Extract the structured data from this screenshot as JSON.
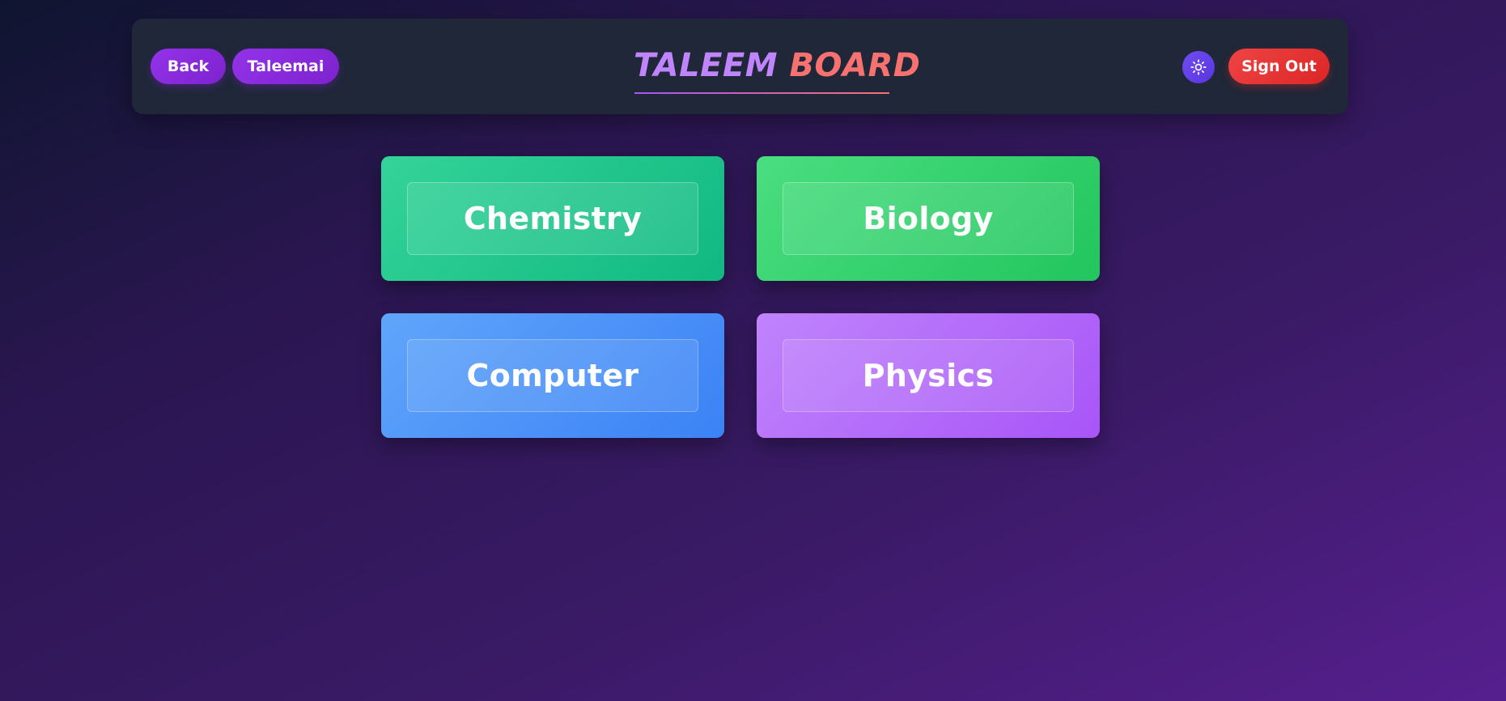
{
  "header": {
    "back_label": "Back",
    "taleemai_label": "Taleemai",
    "brand_part1": "TALEEM",
    "brand_part2": "BOARD",
    "theme_toggle_icon": "sun-icon",
    "signout_label": "Sign Out"
  },
  "subjects": [
    {
      "label": "Chemistry",
      "color": "#10b981"
    },
    {
      "label": "Biology",
      "color": "#22c55e"
    },
    {
      "label": "Computer",
      "color": "#3b82f6"
    },
    {
      "label": "Physics",
      "color": "#a855f7"
    }
  ],
  "colors": {
    "primary_button": "#7e22ce",
    "signout_button": "#dc2626",
    "header_bg": "#1f2738",
    "brand_purple": "#c084fc",
    "brand_red": "#f87171"
  }
}
